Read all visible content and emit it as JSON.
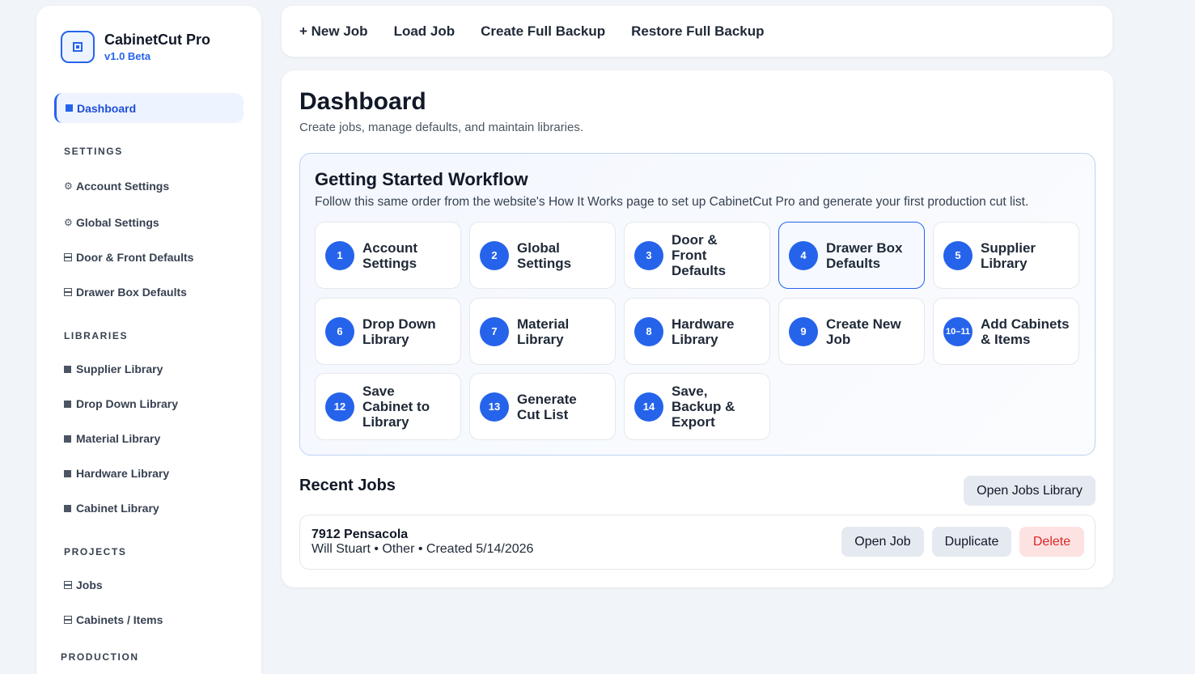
{
  "brand": {
    "name": "CabinetCut Pro",
    "version": "v1.0 Beta",
    "logo_icon": "cabinet-icon"
  },
  "sidebar": {
    "active": {
      "label": "Dashboard"
    },
    "sections": {
      "settings": "SETTINGS",
      "libraries": "LIBRARIES",
      "projects": "PROJECTS",
      "production": "PRODUCTION"
    },
    "items": {
      "account_settings": "Account Settings",
      "global_settings": "Global Settings",
      "door_front_defaults": "Door & Front Defaults",
      "drawer_box_defaults": "Drawer Box Defaults",
      "supplier_library": "Supplier Library",
      "drop_down_library": "Drop Down Library",
      "material_library": "Material Library",
      "hardware_library": "Hardware Library",
      "cabinet_library": "Cabinet Library",
      "jobs": "Jobs",
      "cabinets_items": "Cabinets / Items"
    },
    "icons": {
      "gear": "⚙"
    }
  },
  "toolbar": {
    "new_job": "+ New Job",
    "load_job": "Load Job",
    "create_backup": "Create Full Backup",
    "restore_backup": "Restore Full Backup"
  },
  "page": {
    "title": "Dashboard",
    "subtitle": "Create jobs, manage defaults, and maintain libraries."
  },
  "workflow": {
    "title": "Getting Started Workflow",
    "subtitle": "Follow this same order from the website's How It Works page to set up CabinetCut Pro and generate your first production cut list.",
    "steps": [
      {
        "num": "1",
        "label": "Account Settings"
      },
      {
        "num": "2",
        "label": "Global Settings"
      },
      {
        "num": "3",
        "label": "Door & Front Defaults"
      },
      {
        "num": "4",
        "label": "Drawer Box Defaults"
      },
      {
        "num": "5",
        "label": "Supplier Library"
      },
      {
        "num": "6",
        "label": "Drop Down Library"
      },
      {
        "num": "7",
        "label": "Material Library"
      },
      {
        "num": "8",
        "label": "Hardware Library"
      },
      {
        "num": "9",
        "label": "Create New Job"
      },
      {
        "num": "10–11",
        "label": "Add Cabinets & Items"
      },
      {
        "num": "12",
        "label": "Save Cabinet to Library"
      },
      {
        "num": "13",
        "label": "Generate Cut List"
      },
      {
        "num": "14",
        "label": "Save, Backup & Export"
      }
    ]
  },
  "recent_jobs": {
    "title": "Recent Jobs",
    "open_library": "Open Jobs Library",
    "jobs": [
      {
        "name": "7912 Pensacola",
        "meta": "Will Stuart • Other • Created 5/14/2026",
        "open": "Open Job",
        "duplicate": "Duplicate",
        "delete": "Delete"
      }
    ]
  },
  "colors": {
    "accent": "#2563eb",
    "danger": "#dc2626",
    "background": "#f1f4f8"
  }
}
